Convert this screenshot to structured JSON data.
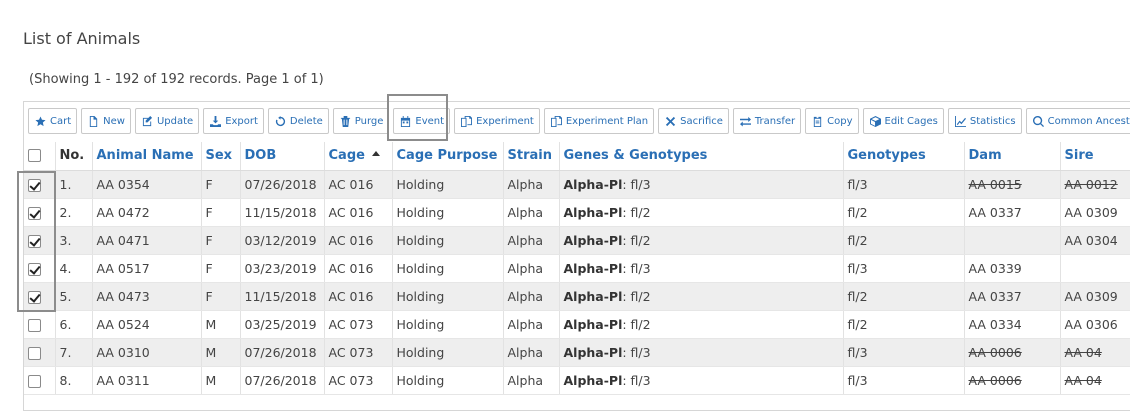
{
  "page": {
    "title": "List of Animals",
    "records_info": "(Showing 1 - 192 of 192 records. Page 1 of 1)"
  },
  "toolbar": {
    "buttons": [
      {
        "label": "Cart",
        "icon": "star-icon"
      },
      {
        "label": "New",
        "icon": "file-icon"
      },
      {
        "label": "Update",
        "icon": "edit-icon"
      },
      {
        "label": "Export",
        "icon": "download-icon"
      },
      {
        "label": "Delete",
        "icon": "recycle-icon"
      },
      {
        "label": "Purge",
        "icon": "trash-icon"
      },
      {
        "label": "Event",
        "icon": "calendar-icon"
      },
      {
        "label": "Experiment",
        "icon": "copy-icon"
      },
      {
        "label": "Experiment Plan",
        "icon": "copy-icon"
      },
      {
        "label": "Sacrifice",
        "icon": "x-icon"
      },
      {
        "label": "Transfer",
        "icon": "exchange-icon"
      },
      {
        "label": "Copy",
        "icon": "clipboard-icon"
      },
      {
        "label": "Edit Cages",
        "icon": "cube-icon"
      },
      {
        "label": "Statistics",
        "icon": "chart-icon"
      },
      {
        "label": "Common Ancestor",
        "icon": "search-icon"
      }
    ]
  },
  "table": {
    "headers": {
      "no": "No.",
      "animal_name": "Animal Name",
      "sex": "Sex",
      "dob": "DOB",
      "cage": "Cage",
      "cage_purpose": "Cage Purpose",
      "strain": "Strain",
      "genes_genotypes": "Genes & Genotypes",
      "genotypes": "Genotypes",
      "dam": "Dam",
      "sire": "Sire"
    },
    "rows": [
      {
        "checked": true,
        "no": "1.",
        "name": "AA 0354",
        "sex": "F",
        "dob": "07/26/2018",
        "cage": "AC 016",
        "purpose": "Holding",
        "strain": "Alpha",
        "gene": "Alpha-Pl",
        "gene_value": ": fl/3",
        "genotype": "fl/3",
        "dam": "AA 0015",
        "sire": "AA 0012"
      },
      {
        "checked": true,
        "no": "2.",
        "name": "AA 0472",
        "sex": "F",
        "dob": "11/15/2018",
        "cage": "AC 016",
        "purpose": "Holding",
        "strain": "Alpha",
        "gene": "Alpha-Pl",
        "gene_value": ": fl/2",
        "genotype": "fl/2",
        "dam": "AA 0337",
        "sire": "AA 0309"
      },
      {
        "checked": true,
        "no": "3.",
        "name": "AA 0471",
        "sex": "F",
        "dob": "03/12/2019",
        "cage": "AC 016",
        "purpose": "Holding",
        "strain": "Alpha",
        "gene": "Alpha-Pl",
        "gene_value": ": fl/2",
        "genotype": "fl/2",
        "dam": "",
        "sire": "AA 0304"
      },
      {
        "checked": true,
        "no": "4.",
        "name": "AA 0517",
        "sex": "F",
        "dob": "03/23/2019",
        "cage": "AC 016",
        "purpose": "Holding",
        "strain": "Alpha",
        "gene": "Alpha-Pl",
        "gene_value": ": fl/3",
        "genotype": "fl/3",
        "dam": "AA 0339",
        "sire": ""
      },
      {
        "checked": true,
        "no": "5.",
        "name": "AA 0473",
        "sex": "F",
        "dob": "11/15/2018",
        "cage": "AC 016",
        "purpose": "Holding",
        "strain": "Alpha",
        "gene": "Alpha-Pl",
        "gene_value": ": fl/2",
        "genotype": "fl/2",
        "dam": "AA 0337",
        "sire": "AA 0309"
      },
      {
        "checked": false,
        "no": "6.",
        "name": "AA 0524",
        "sex": "M",
        "dob": "03/25/2019",
        "cage": "AC 073",
        "purpose": "Holding",
        "strain": "Alpha",
        "gene": "Alpha-Pl",
        "gene_value": ": fl/2",
        "genotype": "fl/2",
        "dam": "AA 0334",
        "sire": "AA 0306"
      },
      {
        "checked": false,
        "no": "7.",
        "name": "AA 0310",
        "sex": "M",
        "dob": "07/26/2018",
        "cage": "AC 073",
        "purpose": "Holding",
        "strain": "Alpha",
        "gene": "Alpha-Pl",
        "gene_value": ": fl/3",
        "genotype": "fl/3",
        "dam": "AA 0006",
        "sire": "AA 04"
      },
      {
        "checked": false,
        "no": "8.",
        "name": "AA 0311",
        "sex": "M",
        "dob": "07/26/2018",
        "cage": "AC 073",
        "purpose": "Holding",
        "strain": "Alpha",
        "gene": "Alpha-Pl",
        "gene_value": ": fl/3",
        "genotype": "fl/3",
        "dam": "AA 0006",
        "sire": "AA 04"
      }
    ]
  },
  "styles": {
    "name_red_rows": [
      "1.",
      "2.",
      "3.",
      "4.",
      "5."
    ],
    "dam_struck_rows": [
      "1.",
      "7.",
      "8."
    ],
    "sire_struck_rows": [
      "1.",
      "7.",
      "8."
    ],
    "link_color": "#2a6fb5",
    "alert_color": "#c0141c"
  }
}
